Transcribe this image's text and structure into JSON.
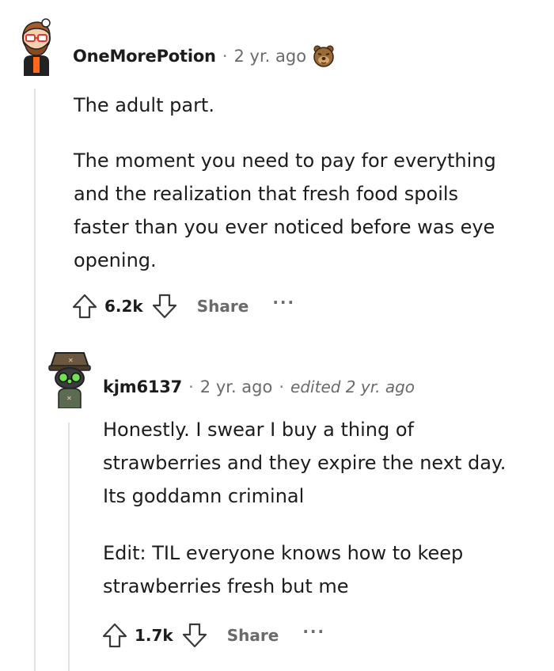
{
  "comment": {
    "username": "OneMorePotion",
    "separator": "·",
    "time": "2 yr. ago",
    "award_icon": "bear-award-icon",
    "paragraphs": [
      "The adult part.",
      "The moment you need to pay for everything and the realization that fresh food spoils faster than you ever noticed before was eye opening."
    ],
    "score": "6.2k",
    "share_label": "Share",
    "more_label": "···"
  },
  "reply": {
    "username": "kjm6137",
    "separator": "·",
    "time": "2 yr. ago",
    "edited": "edited 2 yr. ago",
    "paragraphs": [
      "Honestly. I swear I buy a thing of strawberries and they expire the next day. Its goddamn criminal",
      "Edit: TIL everyone knows how to keep strawberries fresh but me"
    ],
    "score": "1.7k",
    "share_label": "Share",
    "more_label": "···"
  },
  "colors": {
    "thread_line": "#dfe3e6",
    "meta_gray": "#6a6a6a",
    "text": "#1c1c1c"
  }
}
